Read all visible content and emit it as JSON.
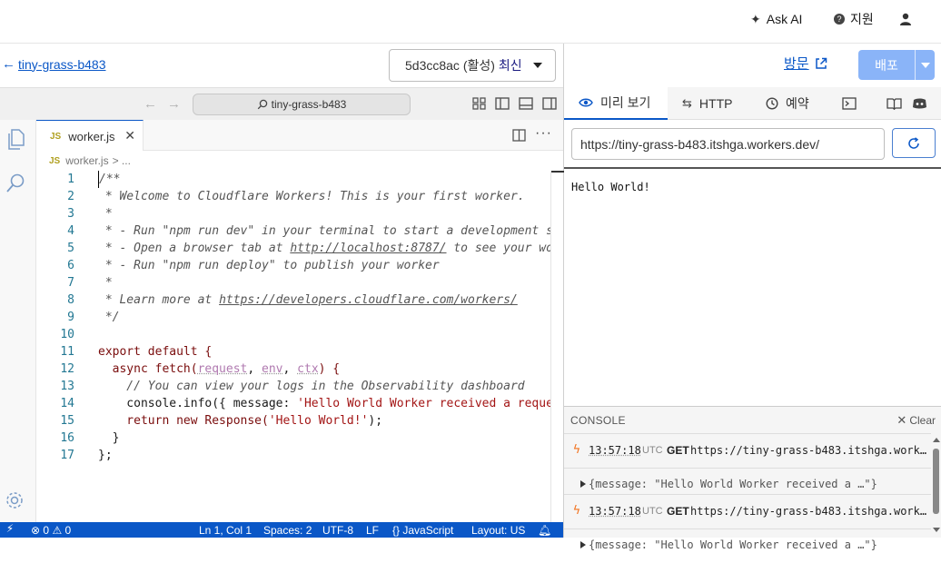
{
  "topbar": {
    "ask_ai": "Ask AI",
    "support": "지원",
    "icons": [
      "sparkle-icon",
      "help-circle-icon",
      "user-icon"
    ]
  },
  "editor_header": {
    "back_label": "tiny-grass-b483",
    "version_id": "5d3cc8ac (활성)",
    "version_latest": "최신"
  },
  "right_header": {
    "visit_label": "방문",
    "deploy_label": "배포"
  },
  "titlebar": {
    "command_center": "tiny-grass-b483"
  },
  "tabs": [
    {
      "badge": "JS",
      "label": "worker.js"
    }
  ],
  "breadcrumbs": {
    "badge": "JS",
    "file": "worker.js",
    "rest": "> ..."
  },
  "code": {
    "line_numbers": [
      "1",
      "2",
      "3",
      "4",
      "5",
      "6",
      "7",
      "8",
      "9",
      "10",
      "11",
      "12",
      "13",
      "14",
      "15",
      "16",
      "17"
    ],
    "lines": [
      "/**",
      " * Welcome to Cloudflare Workers! This is your first worker.",
      " *",
      " * - Run \"npm run dev\" in your terminal to start a development se",
      " * - Open a browser tab at ",
      " * - Run \"npm run deploy\" to publish your worker",
      " *",
      " * Learn more at ",
      " */",
      "",
      "export default {",
      "  async fetch(",
      "    // You can view your logs in the Observability dashboard",
      "    console.info({ message: ",
      "    return new Response(",
      "  }",
      "};"
    ],
    "line5_url": "http://localhost:8787/",
    "line5_tail": " to see your wor",
    "line8_url": "https://developers.cloudflare.com/workers/",
    "line12_params": [
      "request",
      "env",
      "ctx"
    ],
    "line12_tail": ") {",
    "line14_str": "'Hello World Worker received a reques",
    "line15_str": "'Hello World!'",
    "line15_tail": ");"
  },
  "statusbar": {
    "errors": "0",
    "warnings": "0",
    "position": "Ln 1, Col 1",
    "spaces": "Spaces: 2",
    "encoding": "UTF-8",
    "eol": "LF",
    "language": "JavaScript",
    "layout": "Layout: US"
  },
  "right_panel": {
    "tabs": [
      {
        "label": "미리 보기",
        "icon": "eye-icon"
      },
      {
        "label": "HTTP",
        "icon": "arrows-icon"
      },
      {
        "label": "예약",
        "icon": "clock-icon"
      }
    ],
    "url": "https://tiny-grass-b483.itshga.workers.dev/",
    "preview_text": "Hello World!"
  },
  "console": {
    "title": "CONSOLE",
    "clear_label": "Clear",
    "entries": [
      {
        "time": "13:57:18",
        "tz": "UTC",
        "method": "GET",
        "url": "https://tiny-grass-b483.itshga.work…"
      },
      {
        "object": "{message: \"Hello World Worker received a …\"}"
      },
      {
        "time": "13:57:18",
        "tz": "UTC",
        "method": "GET",
        "url": "https://tiny-grass-b483.itshga.work…"
      },
      {
        "object": "{message: \"Hello World Worker received a …\"}"
      }
    ]
  },
  "colors": {
    "accent": "#0a57c7",
    "deploy_bg": "#8ab4f8",
    "statusbar_bg": "#0a57c7"
  }
}
